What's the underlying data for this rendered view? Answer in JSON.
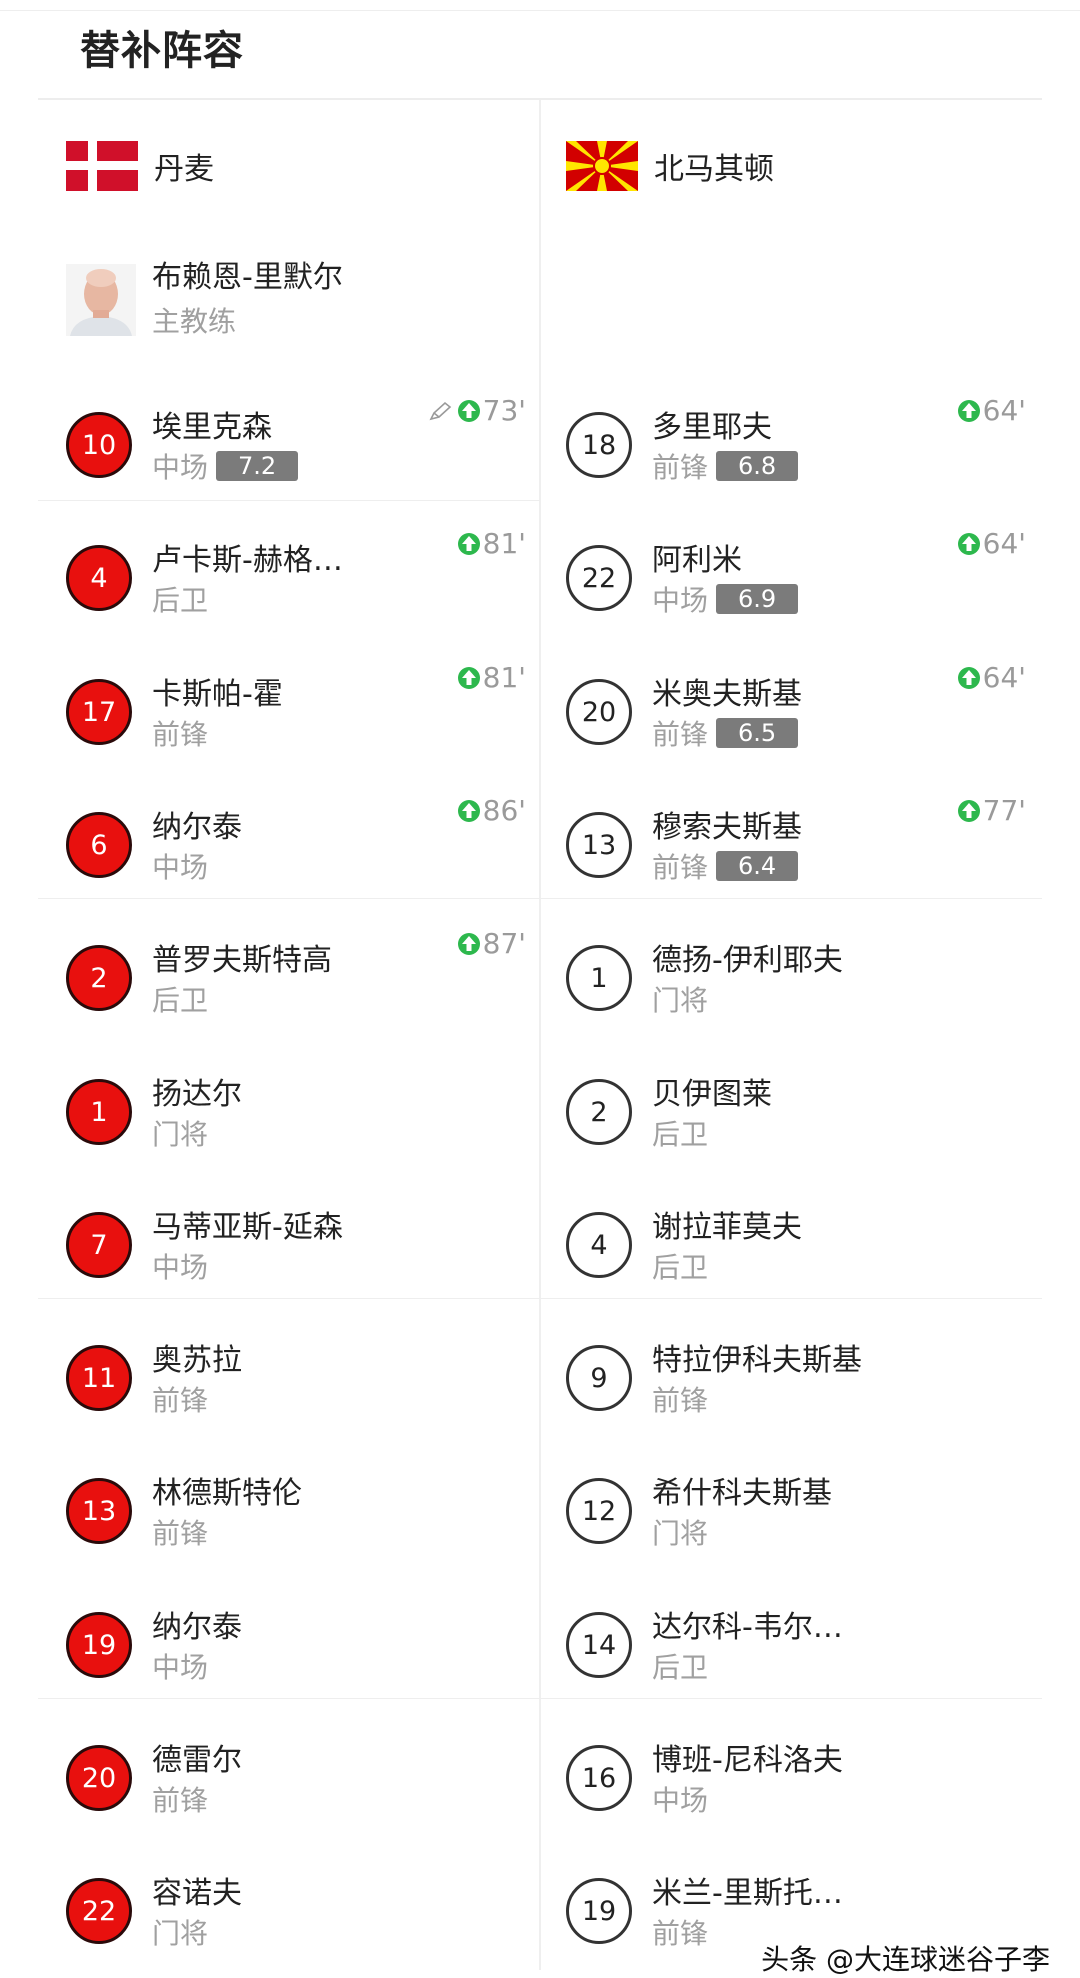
{
  "section_title": "替补阵容",
  "teams": {
    "home": {
      "name": "丹麦",
      "coach": {
        "name": "布赖恩-里默尔",
        "role": "主教练"
      },
      "players": [
        {
          "number": "10",
          "name": "埃里克森",
          "role": "中场",
          "rating": "7.2",
          "sub": "73'",
          "note_icon": true
        },
        {
          "number": "4",
          "name": "卢卡斯-赫格…",
          "role": "后卫",
          "rating": "",
          "sub": "81'"
        },
        {
          "number": "17",
          "name": "卡斯帕-霍",
          "role": "前锋",
          "rating": "",
          "sub": "81'"
        },
        {
          "number": "6",
          "name": "纳尔泰",
          "role": "中场",
          "rating": "",
          "sub": "86'"
        },
        {
          "number": "2",
          "name": "普罗夫斯特高",
          "role": "后卫",
          "rating": "",
          "sub": "87'"
        },
        {
          "number": "1",
          "name": "扬达尔",
          "role": "门将",
          "rating": "",
          "sub": ""
        },
        {
          "number": "7",
          "name": "马蒂亚斯-延森",
          "role": "中场",
          "rating": "",
          "sub": ""
        },
        {
          "number": "11",
          "name": "奥苏拉",
          "role": "前锋",
          "rating": "",
          "sub": ""
        },
        {
          "number": "13",
          "name": "林德斯特伦",
          "role": "前锋",
          "rating": "",
          "sub": ""
        },
        {
          "number": "19",
          "name": "纳尔泰",
          "role": "中场",
          "rating": "",
          "sub": ""
        },
        {
          "number": "20",
          "name": "德雷尔",
          "role": "前锋",
          "rating": "",
          "sub": ""
        },
        {
          "number": "22",
          "name": "容诺夫",
          "role": "门将",
          "rating": "",
          "sub": ""
        }
      ]
    },
    "away": {
      "name": "北马其顿",
      "players": [
        {
          "number": "18",
          "name": "多里耶夫",
          "role": "前锋",
          "rating": "6.8",
          "sub": "64'"
        },
        {
          "number": "22",
          "name": "阿利米",
          "role": "中场",
          "rating": "6.9",
          "sub": "64'"
        },
        {
          "number": "20",
          "name": "米奥夫斯基",
          "role": "前锋",
          "rating": "6.5",
          "sub": "64'"
        },
        {
          "number": "13",
          "name": "穆索夫斯基",
          "role": "前锋",
          "rating": "6.4",
          "sub": "77'"
        },
        {
          "number": "1",
          "name": "德扬-伊利耶夫",
          "role": "门将",
          "rating": "",
          "sub": ""
        },
        {
          "number": "2",
          "name": "贝伊图莱",
          "role": "后卫",
          "rating": "",
          "sub": ""
        },
        {
          "number": "4",
          "name": "谢拉菲莫夫",
          "role": "后卫",
          "rating": "",
          "sub": ""
        },
        {
          "number": "9",
          "name": "特拉伊科夫斯基",
          "role": "前锋",
          "rating": "",
          "sub": ""
        },
        {
          "number": "12",
          "name": "希什科夫斯基",
          "role": "门将",
          "rating": "",
          "sub": ""
        },
        {
          "number": "14",
          "name": "达尔科-韦尔…",
          "role": "后卫",
          "rating": "",
          "sub": ""
        },
        {
          "number": "16",
          "name": "博班-尼科洛夫",
          "role": "中场",
          "rating": "",
          "sub": ""
        },
        {
          "number": "19",
          "name": "米兰-里斯托…",
          "role": "前锋",
          "rating": "",
          "sub": ""
        }
      ]
    }
  },
  "watermark": "头条 @大连球迷谷子李",
  "colors": {
    "home_badge": "#e8100e",
    "sub_arrow": "#2db84d",
    "rating_bg": "#7b7b7b"
  }
}
